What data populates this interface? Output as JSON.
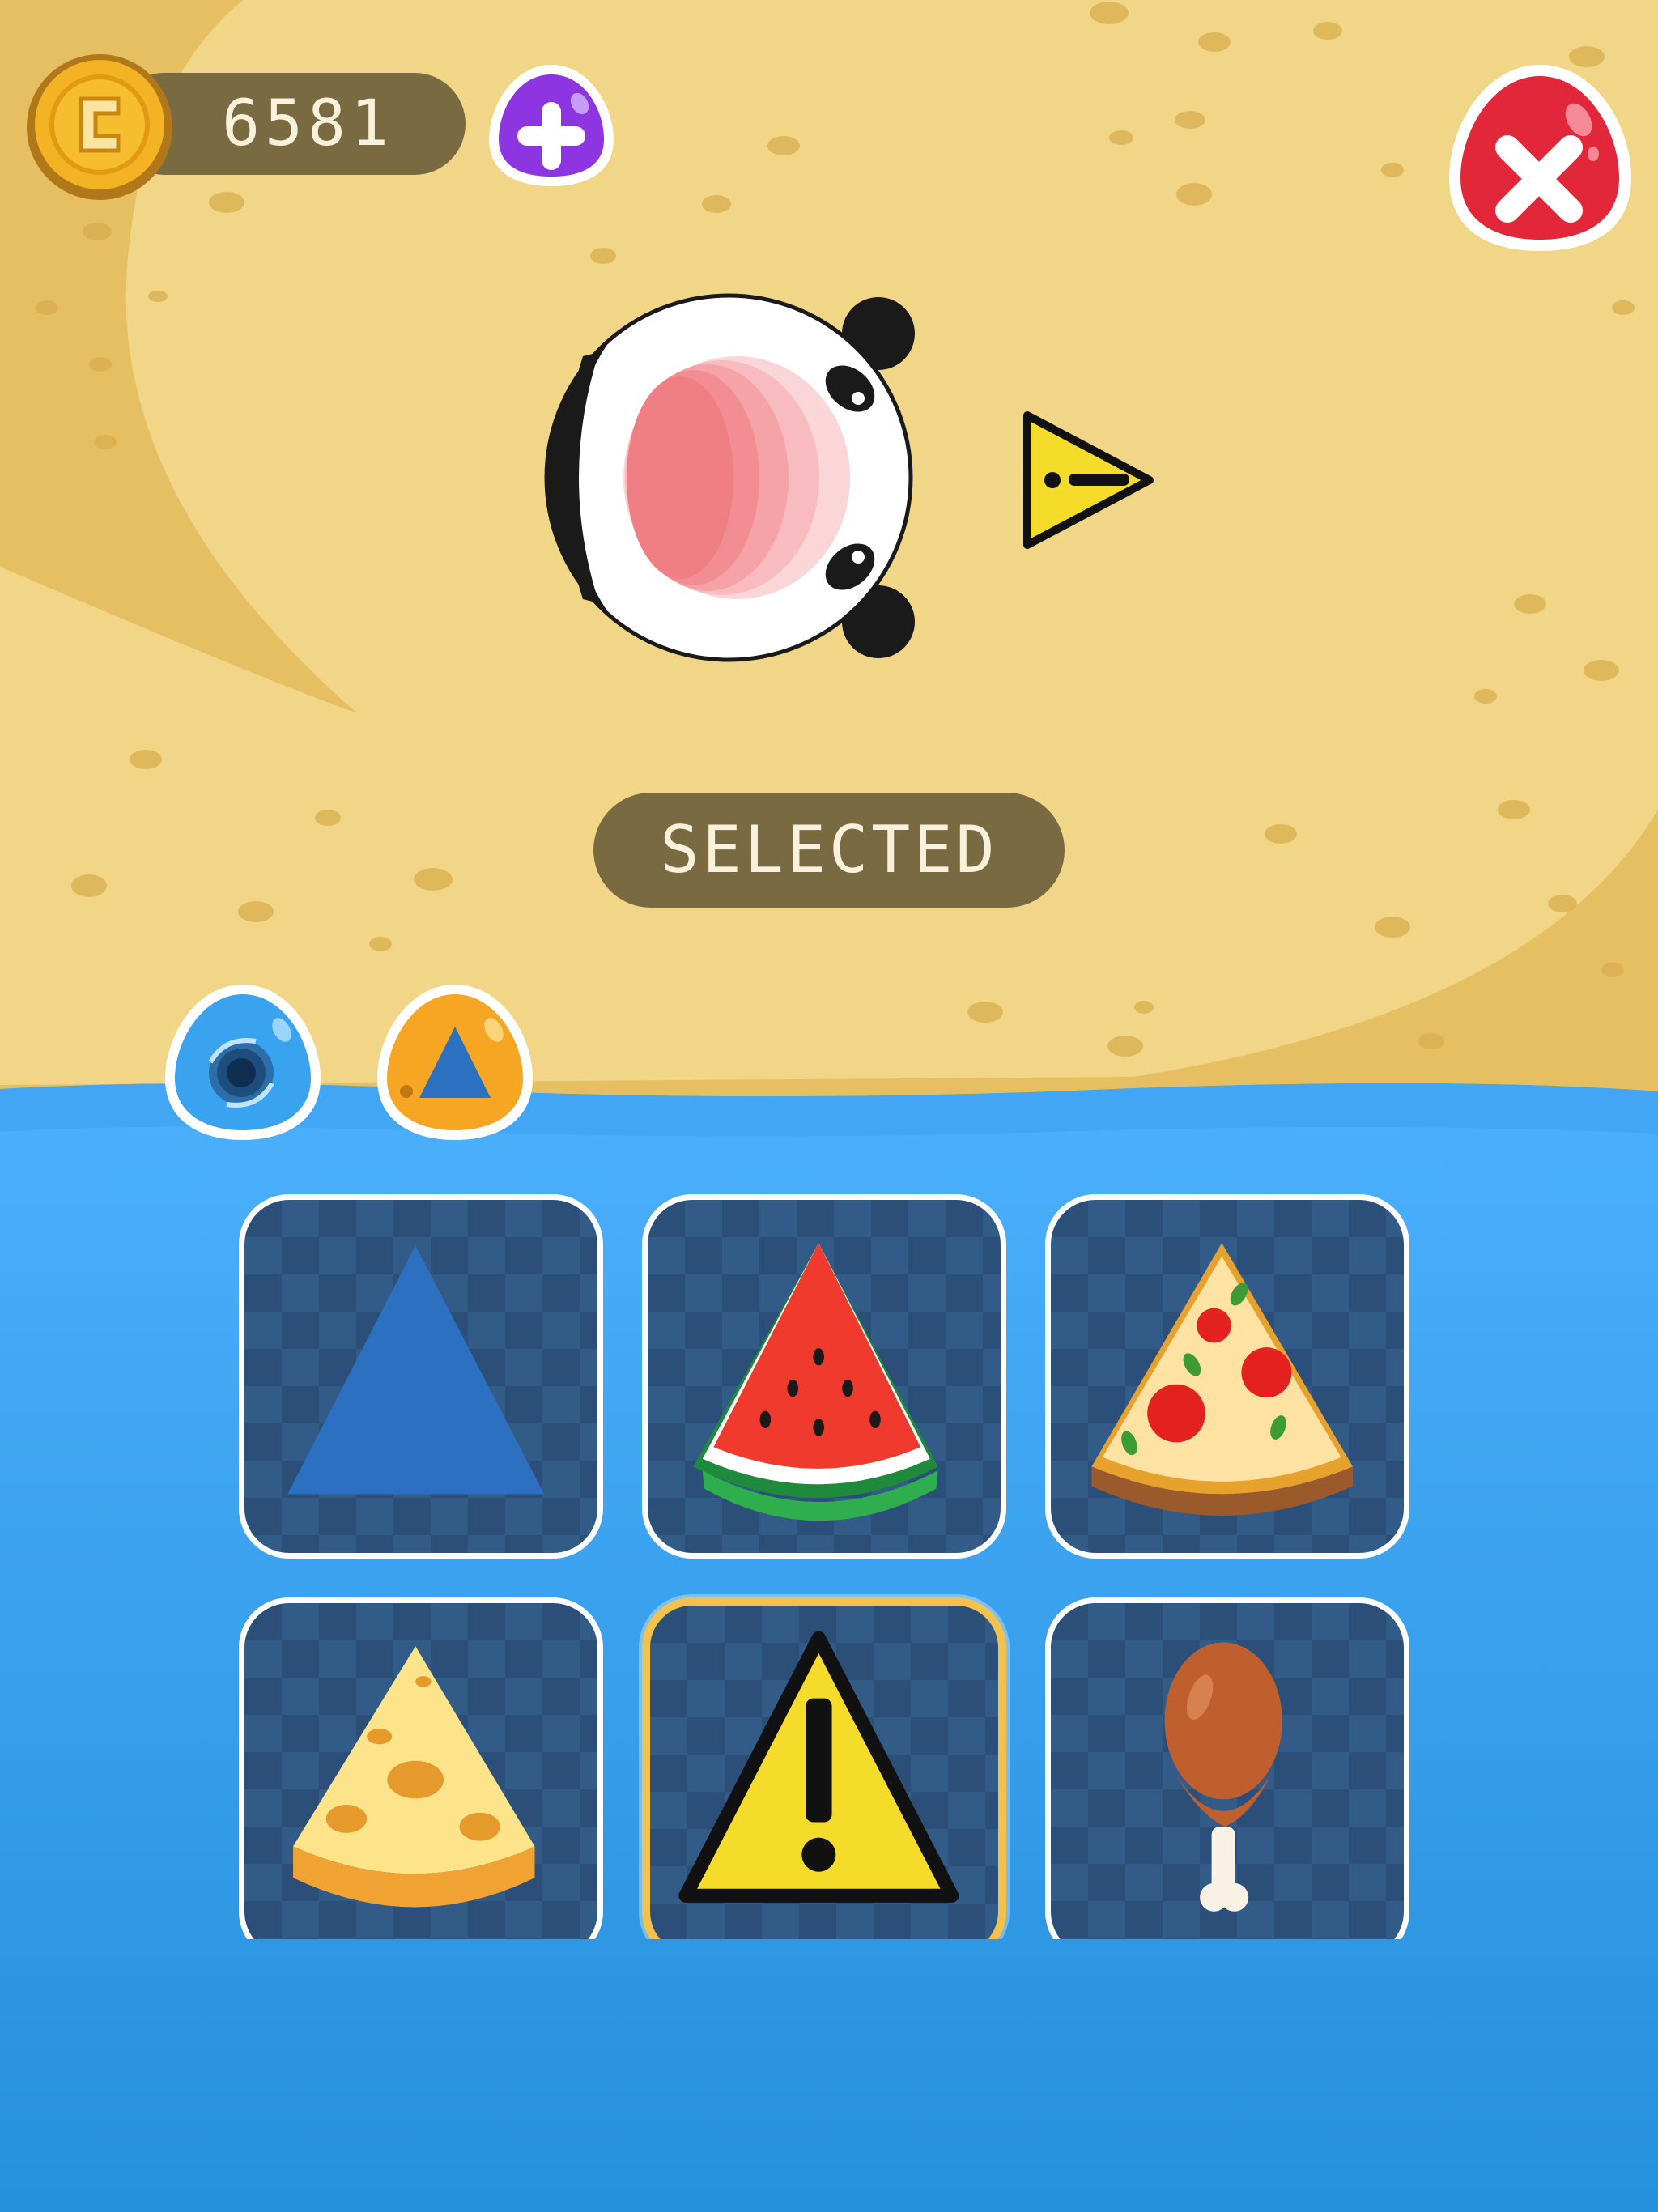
{
  "currency": {
    "coin_icon": "coin-icon",
    "amount": "6581",
    "add_icon": "plus-icon"
  },
  "close_icon": "close-icon",
  "preview": {
    "character": "panda-hole",
    "pointer_shape": "warning-sign-shape"
  },
  "selected_label": "SELECTED",
  "tabs": [
    {
      "name": "holes",
      "icon": "hole-icon",
      "color": "#3aa3f0"
    },
    {
      "name": "shapes",
      "icon": "triangle-icon",
      "color": "#f6a623"
    }
  ],
  "items": [
    {
      "name": "blue-triangle",
      "icon": "triangle-icon"
    },
    {
      "name": "watermelon",
      "icon": "watermelon-icon"
    },
    {
      "name": "pizza",
      "icon": "pizza-icon"
    },
    {
      "name": "cheese",
      "icon": "cheese-icon"
    },
    {
      "name": "warning-sign",
      "icon": "warning-icon",
      "selected": true
    },
    {
      "name": "chicken-leg",
      "icon": "chicken-leg-icon"
    }
  ],
  "colors": {
    "sand": "#f2d688",
    "sand_dark": "#e6bf62",
    "water_top": "#4aaefc",
    "water_bottom": "#2590dc",
    "badge": "#7a6a42",
    "selected_border": "#f2c14e"
  }
}
